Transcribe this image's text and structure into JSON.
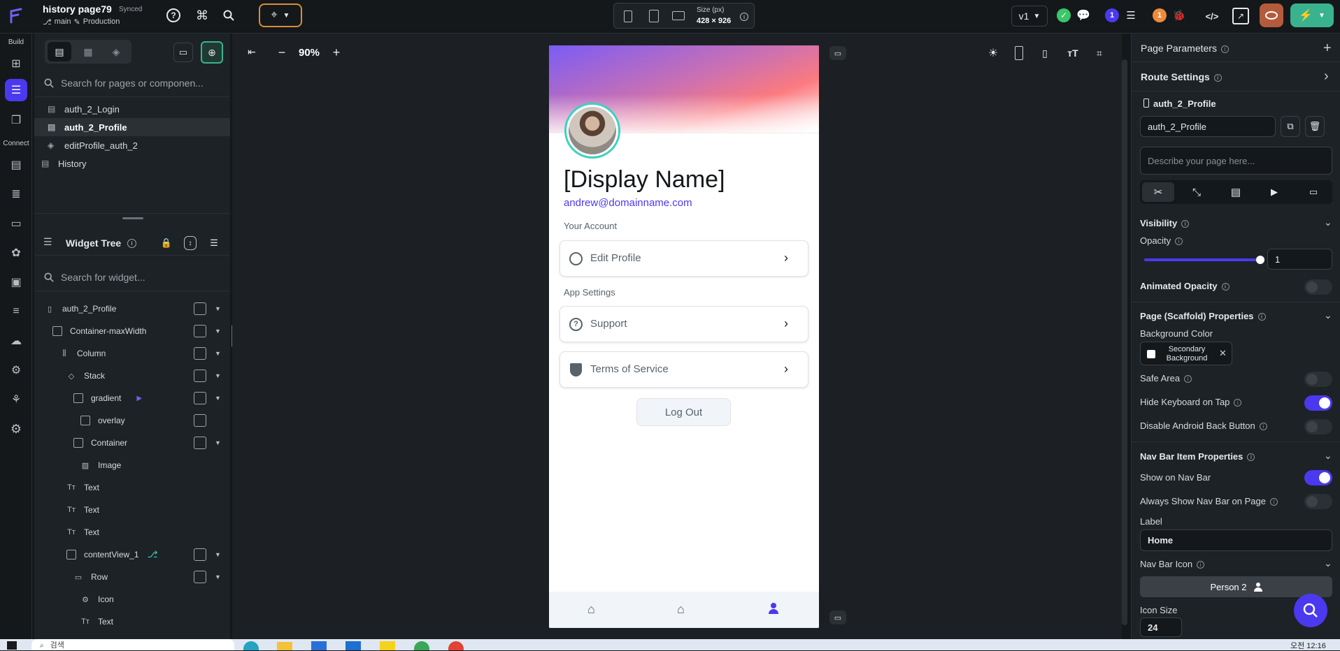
{
  "topbar": {
    "project_title": "history page79",
    "sync_status": "Synced",
    "branch": "main",
    "environment": "Production",
    "size_label": "Size (px)",
    "size_value": "428 × 926",
    "version": "v1",
    "badge_one": "1",
    "badge_two": "1"
  },
  "rail": {
    "build_label": "Build",
    "connect_label": "Connect"
  },
  "left_panel": {
    "search_pages_placeholder": "Search for pages or componen...",
    "pages": [
      {
        "label": "auth_2_Login",
        "icon": "page-icon"
      },
      {
        "label": "auth_2_Profile",
        "icon": "page-icon",
        "selected": true
      },
      {
        "label": "editProfile_auth_2",
        "icon": "component-icon"
      },
      {
        "label": "History",
        "icon": "page-icon"
      }
    ],
    "widget_tree_title": "Widget Tree",
    "search_widget_placeholder": "Search for widget...",
    "tree": [
      {
        "label": "auth_2_Profile",
        "icon": "phone-icon"
      },
      {
        "label": "Container-maxWidth",
        "icon": "container-icon"
      },
      {
        "label": "Column",
        "icon": "column-icon"
      },
      {
        "label": "Stack",
        "icon": "stack-icon"
      },
      {
        "label": "gradient",
        "icon": "container-icon"
      },
      {
        "label": "overlay",
        "icon": "container-icon"
      },
      {
        "label": "Container",
        "icon": "container-icon"
      },
      {
        "label": "Image",
        "icon": "image-icon"
      },
      {
        "label": "Text",
        "icon": "text-icon"
      },
      {
        "label": "Text",
        "icon": "text-icon"
      },
      {
        "label": "Text",
        "icon": "text-icon"
      },
      {
        "label": "contentView_1",
        "icon": "container-icon"
      },
      {
        "label": "Row",
        "icon": "row-icon"
      },
      {
        "label": "Icon",
        "icon": "gear-icon"
      },
      {
        "label": "Text",
        "icon": "text-icon"
      }
    ]
  },
  "canvas": {
    "zoom": "90%"
  },
  "phone": {
    "display_name": "[Display Name]",
    "email": "andrew@domainname.com",
    "section_account": "Your Account",
    "edit_profile": "Edit Profile",
    "section_app": "App Settings",
    "support": "Support",
    "terms": "Terms of Service",
    "logout": "Log Out",
    "gradient_colors": [
      "#7b5cf5",
      "#f07a8a",
      "#ffffff"
    ],
    "accent": "#4b39ef"
  },
  "right_panel": {
    "page_parameters": "Page Parameters",
    "route_settings": "Route Settings",
    "page_name_heading": "auth_2_Profile",
    "page_name_value": "auth_2_Profile",
    "describe_placeholder": "Describe your page here...",
    "visibility": "Visibility",
    "opacity_label": "Opacity",
    "opacity_value": "1",
    "animated_opacity": "Animated Opacity",
    "scaffold_props": "Page (Scaffold) Properties",
    "bg_color_label": "Background Color",
    "bg_color_value": "Secondary Background",
    "safe_area": "Safe Area",
    "hide_keyboard": "Hide Keyboard on Tap",
    "disable_back": "Disable Android Back Button",
    "nav_bar_props": "Nav Bar Item Properties",
    "show_nav": "Show on Nav Bar",
    "always_show_nav": "Always Show Nav Bar on Page",
    "label_label": "Label",
    "label_value": "Home",
    "nav_icon_label": "Nav Bar Icon",
    "nav_icon_value": "Person 2",
    "icon_size_label": "Icon Size",
    "icon_size_value": "24",
    "toggles": {
      "animated_opacity": false,
      "safe_area": false,
      "hide_keyboard": true,
      "disable_back": false,
      "show_nav": true,
      "always_show_nav": false
    }
  },
  "taskbar": {
    "search_text": "검색",
    "clock": "오전 12:16"
  }
}
